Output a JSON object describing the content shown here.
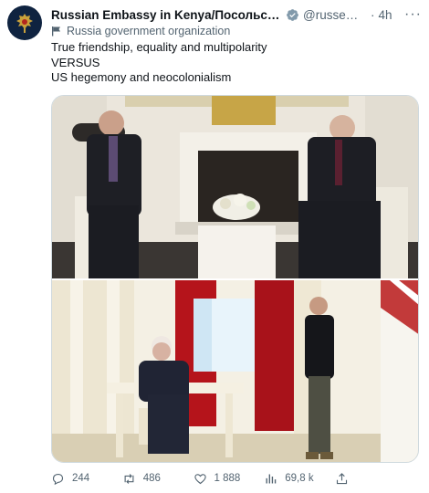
{
  "author": {
    "name": "Russian Embassy in Kenya/Посольство Рос...",
    "handle": "@russemb...",
    "separator": "·",
    "time": "4h",
    "more": "···",
    "affiliation": "Russia government organization"
  },
  "tweet": {
    "lines": [
      "True friendship, equality and multipolarity",
      "VERSUS",
      "US hegemony and neocolonialism"
    ]
  },
  "actions": {
    "replies": "244",
    "reposts": "486",
    "likes": "1 888",
    "views": "69,8 k"
  },
  "colors": {
    "verified": "#829aab",
    "text_secondary": "#536471",
    "avatar_bg": "#0f2340"
  },
  "icons": {
    "reply": "speech-bubble",
    "repost": "two-arrows-loop",
    "like": "heart",
    "views": "bar-chart",
    "share": "upload-arrow"
  }
}
